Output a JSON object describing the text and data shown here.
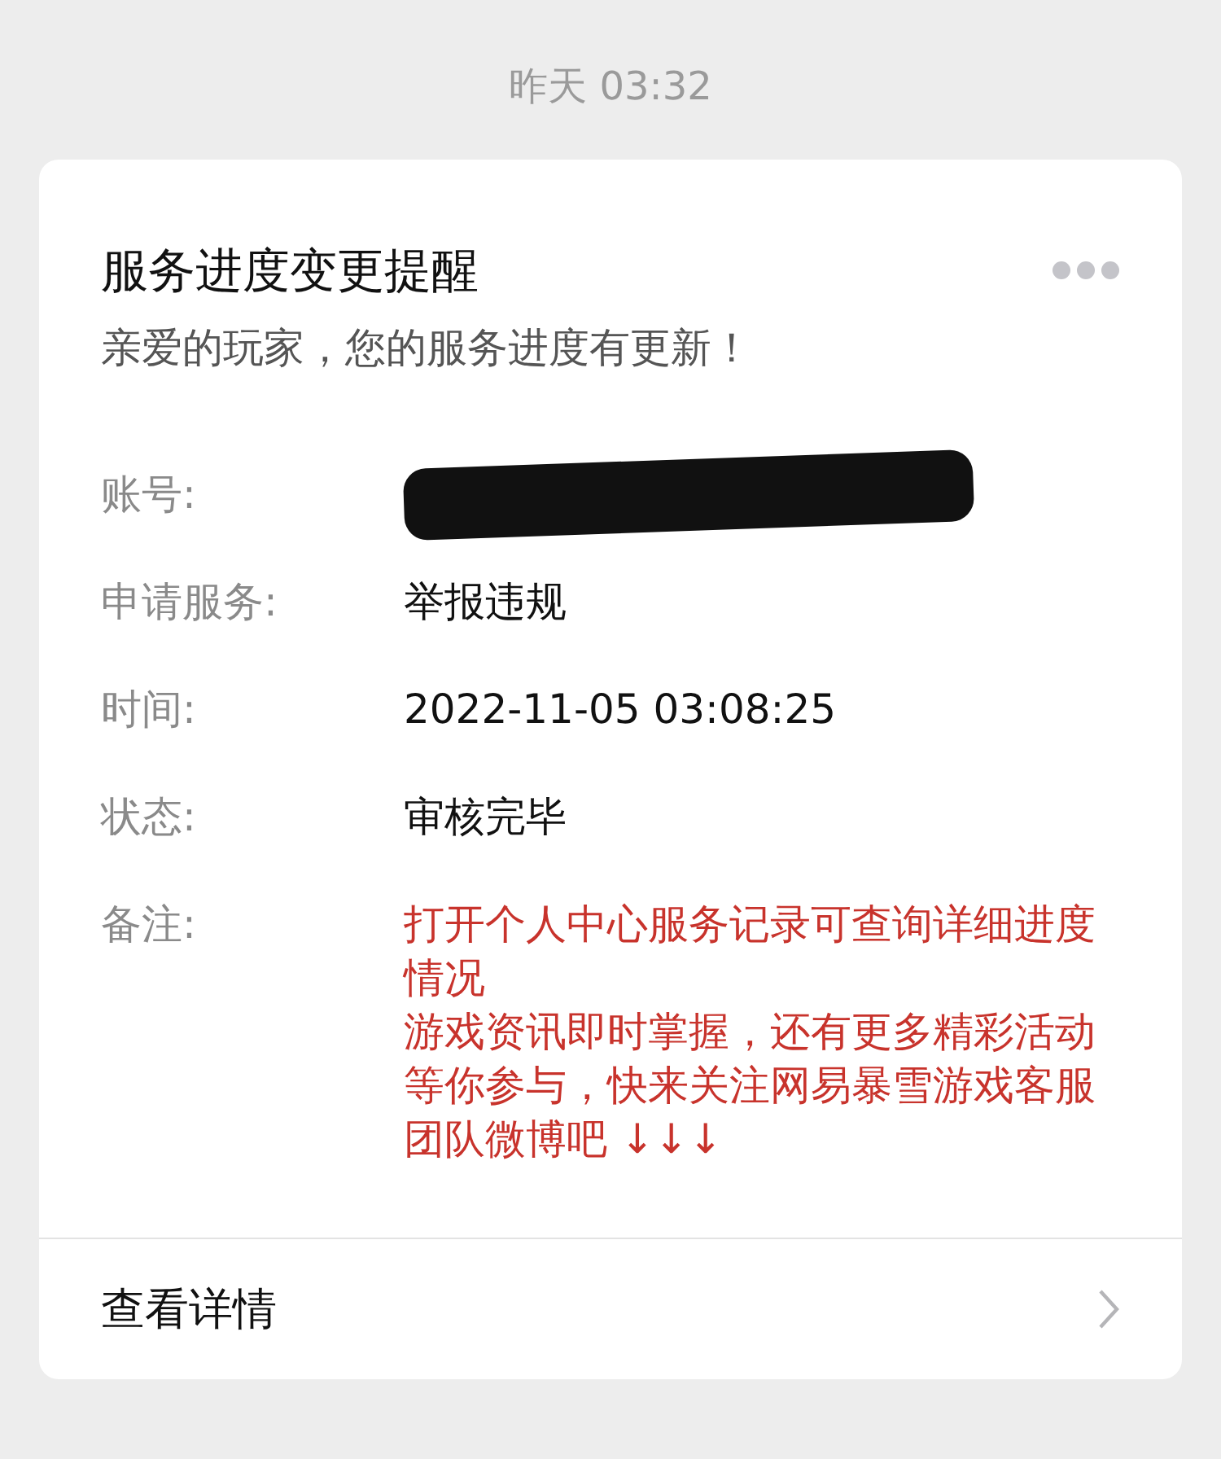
{
  "timestamp": "昨天 03:32",
  "card": {
    "title": "服务进度变更提醒",
    "subtitle": "亲爱的玩家，您的服务进度有更新！",
    "fields": [
      {
        "label": "账号:",
        "kind": "redacted"
      },
      {
        "label": "申请服务:",
        "kind": "text",
        "value": "举报违规"
      },
      {
        "label": "时间:",
        "kind": "text",
        "value": "2022-11-05 03:08:25"
      },
      {
        "label": "状态:",
        "kind": "text",
        "value": "审核完毕"
      },
      {
        "label": "备注:",
        "kind": "note",
        "lines": [
          "打开个人中心服务记录可查询详细进度情况",
          "游戏资讯即时掌握，还有更多精彩活动等你参与，快来关注网易暴雪游戏客服团队微博吧 ↓↓↓"
        ]
      }
    ],
    "footer_link": "查看详情"
  }
}
